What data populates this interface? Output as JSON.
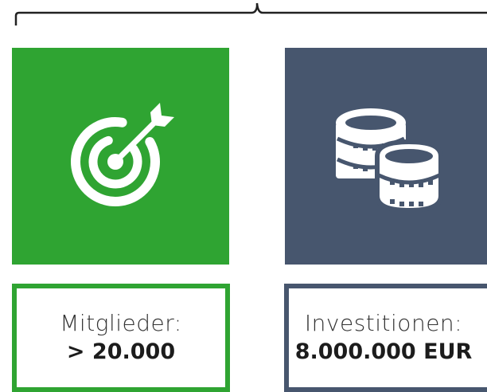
{
  "colors": {
    "green": "#2fa432",
    "slate": "#47566e",
    "text": "#333333"
  },
  "tiles": [
    {
      "icon": "target-arrow-icon",
      "label": "Mitglieder:",
      "value": "> 20.000"
    },
    {
      "icon": "coins-icon",
      "label": "Investitionen:",
      "value": "8.000.000 EUR"
    }
  ]
}
